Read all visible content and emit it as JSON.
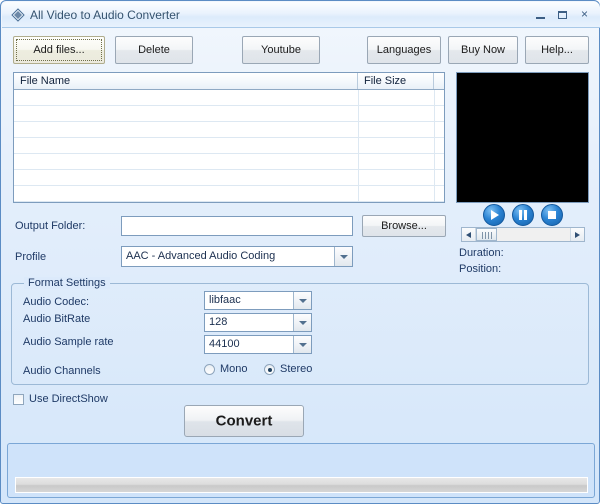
{
  "window": {
    "title": "All Video to Audio Converter",
    "icon": "app-diamond-icon",
    "minimize_label": "Minimize",
    "maximize_label": "Maximize",
    "close_label": "×",
    "frame_color": "#5b8cc4",
    "background_color": "#dceafb"
  },
  "toolbar": {
    "add_files": "Add files...",
    "delete": "Delete",
    "youtube": "Youtube",
    "languages": "Languages",
    "buy_now": "Buy Now",
    "help": "Help..."
  },
  "file_list": {
    "columns": [
      "File Name",
      "File Size",
      ""
    ],
    "rows": [],
    "empty_row_count": 8
  },
  "preview": {
    "screen_color": "#000000",
    "play_label": "Play",
    "pause_label": "Pause",
    "stop_label": "Stop",
    "seek_left_label": "Seek back",
    "seek_right_label": "Seek forward",
    "duration_label": "Duration:",
    "duration_value": "",
    "position_label": "Position:",
    "position_value": ""
  },
  "output": {
    "folder_label": "Output Folder:",
    "folder_value": "",
    "folder_placeholder": "",
    "browse_label": "Browse..."
  },
  "profile": {
    "label": "Profile",
    "value": "AAC - Advanced Audio Coding"
  },
  "format_settings": {
    "group_title": "Format Settings",
    "codec_label": "Audio Codec:",
    "codec_value": "libfaac",
    "bitrate_label": "Audio BitRate",
    "bitrate_value": "128",
    "samplerate_label": "Audio Sample rate",
    "samplerate_value": "44100",
    "channels_label": "Audio Channels",
    "mono_label": "Mono",
    "stereo_label": "Stereo",
    "channels_selected": "Stereo"
  },
  "directshow": {
    "label": "Use DirectShow",
    "checked": false
  },
  "convert": {
    "label": "Convert"
  },
  "status": {
    "progress_percent": 0,
    "message": ""
  }
}
